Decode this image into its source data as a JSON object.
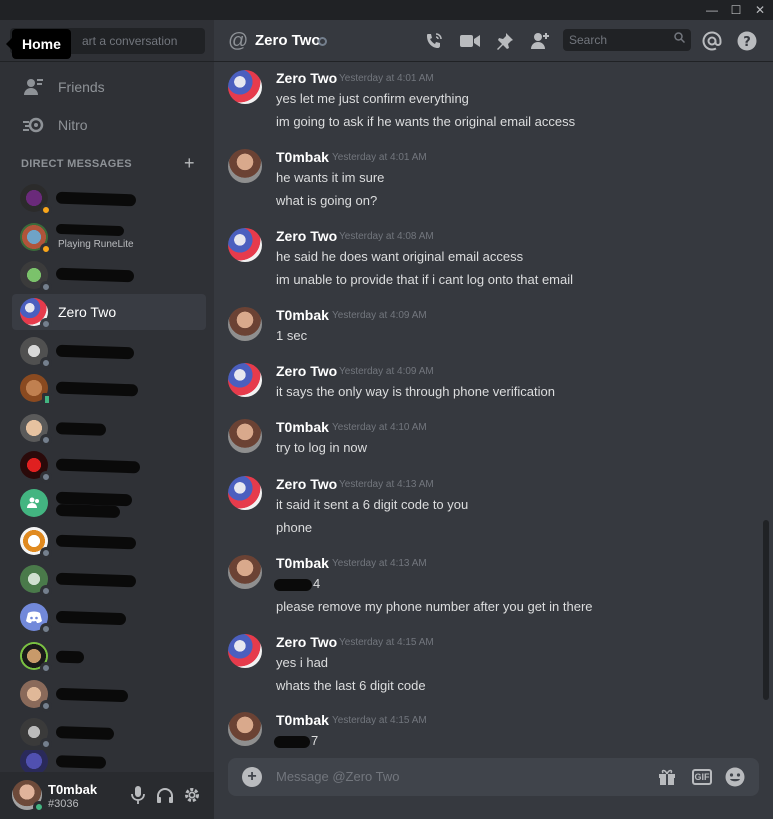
{
  "window": {
    "minimize": "—",
    "maximize": "☐",
    "close": "✕"
  },
  "sidebar": {
    "find_placeholder": "art a conversation",
    "home_tooltip": "Home",
    "friends": "Friends",
    "nitro": "Nitro",
    "dm_header": "DIRECT MESSAGES",
    "dm_add": "+",
    "active_dm": "Zero Two",
    "activity": "Playing RuneLite"
  },
  "user": {
    "name": "T0mbak",
    "tag": "#3036"
  },
  "channel": {
    "name": "Zero Two",
    "search_placeholder": "Search"
  },
  "messages": [
    {
      "author": "Zero Two",
      "time": "Yesterday at 4:01 AM",
      "lines": [
        "yes let me just confirm everything",
        "im going to ask if he wants the original email access"
      ]
    },
    {
      "author": "T0mbak",
      "time": "Yesterday at 4:01 AM",
      "lines": [
        "he wants it im sure",
        "what is going on?"
      ]
    },
    {
      "author": "Zero Two",
      "time": "Yesterday at 4:08 AM",
      "lines": [
        "he said he does want original email access",
        "im unable to provide that if i cant log onto that email"
      ]
    },
    {
      "author": "T0mbak",
      "time": "Yesterday at 4:09 AM",
      "lines": [
        "1 sec"
      ]
    },
    {
      "author": "Zero Two",
      "time": "Yesterday at 4:09 AM",
      "lines": [
        "it says the only way is through phone verification"
      ]
    },
    {
      "author": "T0mbak",
      "time": "Yesterday at 4:10 AM",
      "lines": [
        "try to log in now"
      ]
    },
    {
      "author": "Zero Two",
      "time": "Yesterday at 4:13 AM",
      "lines": [
        "it said it sent a 6 digit code to you",
        "phone"
      ]
    },
    {
      "author": "T0mbak",
      "time": "Yesterday at 4:13 AM",
      "lines": [
        "4",
        "please remove my phone number after you get in there"
      ]
    },
    {
      "author": "Zero Two",
      "time": "Yesterday at 4:15 AM",
      "lines": [
        "yes i had",
        "whats the last 6 digit code"
      ]
    },
    {
      "author": "T0mbak",
      "time": "Yesterday at 4:15 AM",
      "lines": [
        "7"
      ]
    }
  ],
  "composer": {
    "placeholder": "Message @Zero Two",
    "gif": "GIF"
  },
  "colors": {
    "background": "#36393f",
    "sidebar": "#2f3136",
    "online": "#43b581",
    "idle": "#faa61a"
  }
}
